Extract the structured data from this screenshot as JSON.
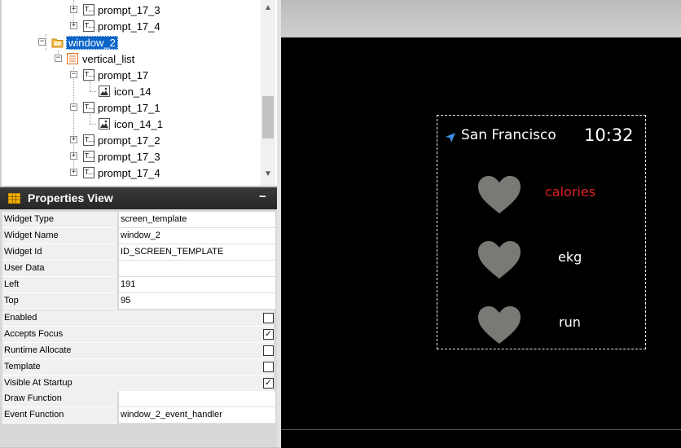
{
  "tree": {
    "items": [
      {
        "label": "prompt_17_3",
        "icon": "text-widget-icon",
        "expander": "+"
      },
      {
        "label": "prompt_17_4",
        "icon": "text-widget-icon",
        "expander": "+"
      },
      {
        "label": "window_2",
        "icon": "folder-icon",
        "expander": "−",
        "selected": true
      },
      {
        "label": "vertical_list",
        "icon": "list-icon",
        "expander": "−"
      },
      {
        "label": "prompt_17",
        "icon": "text-widget-icon",
        "expander": "−"
      },
      {
        "label": "icon_14",
        "icon": "image-widget-icon"
      },
      {
        "label": "prompt_17_1",
        "icon": "text-widget-icon",
        "expander": "−"
      },
      {
        "label": "icon_14_1",
        "icon": "image-widget-icon"
      },
      {
        "label": "prompt_17_2",
        "icon": "text-widget-icon",
        "expander": "+"
      },
      {
        "label": "prompt_17_3",
        "icon": "text-widget-icon",
        "expander": "+"
      },
      {
        "label": "prompt_17_4",
        "icon": "text-widget-icon",
        "expander": "+"
      }
    ],
    "text_icon_glyph": "T..."
  },
  "properties": {
    "title": "Properties View",
    "collapse_label": "−",
    "rows": [
      {
        "name": "Widget Type",
        "value": "screen_template"
      },
      {
        "name": "Widget Name",
        "value": "window_2"
      },
      {
        "name": "Widget Id",
        "value": "ID_SCREEN_TEMPLATE"
      },
      {
        "name": "User Data",
        "value": ""
      },
      {
        "name": "Left",
        "value": "191"
      },
      {
        "name": "Top",
        "value": "95"
      }
    ],
    "checks": [
      {
        "name": "Enabled",
        "checked": false
      },
      {
        "name": "Accepts Focus",
        "checked": true
      },
      {
        "name": "Runtime Allocate",
        "checked": false
      },
      {
        "name": "Template",
        "checked": false
      },
      {
        "name": "Visible At Startup",
        "checked": true
      }
    ],
    "rows2": [
      {
        "name": "Draw Function",
        "value": ""
      },
      {
        "name": "Event Function",
        "value": "window_2_event_handler"
      }
    ]
  },
  "preview": {
    "location": "San Francisco",
    "time": "10:32",
    "items": [
      {
        "label": "calories",
        "color": "#e02020"
      },
      {
        "label": "ekg",
        "color": "#ffffff"
      },
      {
        "label": "run",
        "color": "#ffffff"
      }
    ],
    "heart_color": "#777a75"
  }
}
